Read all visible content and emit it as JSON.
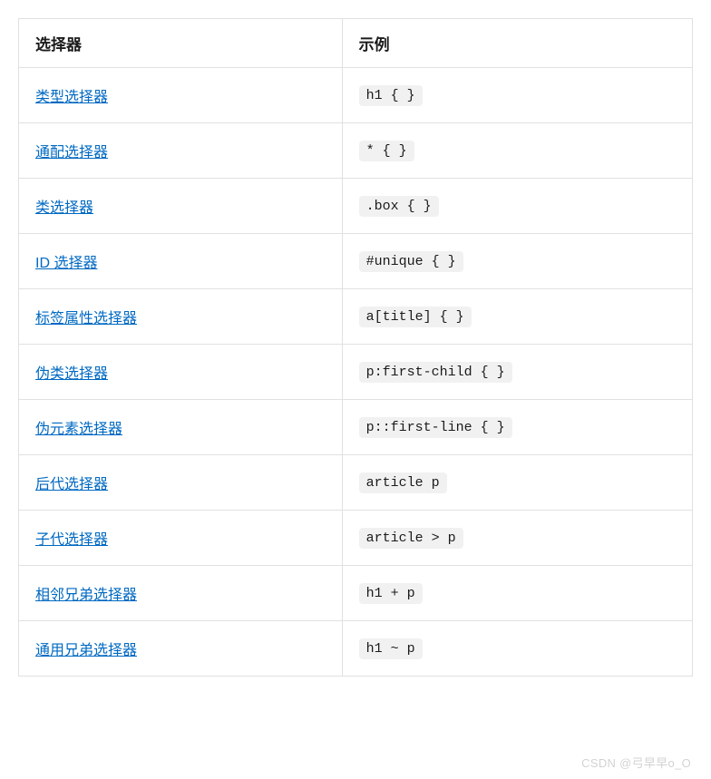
{
  "table": {
    "headers": {
      "selector": "选择器",
      "example": "示例"
    },
    "rows": [
      {
        "label": "类型选择器",
        "example": "h1 { }"
      },
      {
        "label": "通配选择器",
        "example": "* { }"
      },
      {
        "label": "类选择器",
        "example": ".box { }"
      },
      {
        "label": "ID 选择器",
        "example": "#unique { }"
      },
      {
        "label": "标签属性选择器",
        "example": "a[title] { }"
      },
      {
        "label": "伪类选择器",
        "example": "p:first-child { }"
      },
      {
        "label": "伪元素选择器",
        "example": "p::first-line { }"
      },
      {
        "label": "后代选择器",
        "example": "article p"
      },
      {
        "label": "子代选择器",
        "example": "article > p"
      },
      {
        "label": "相邻兄弟选择器",
        "example": "h1 + p"
      },
      {
        "label": "通用兄弟选择器",
        "example": "h1 ~ p"
      }
    ]
  },
  "watermark": "CSDN @弓早早o_O"
}
